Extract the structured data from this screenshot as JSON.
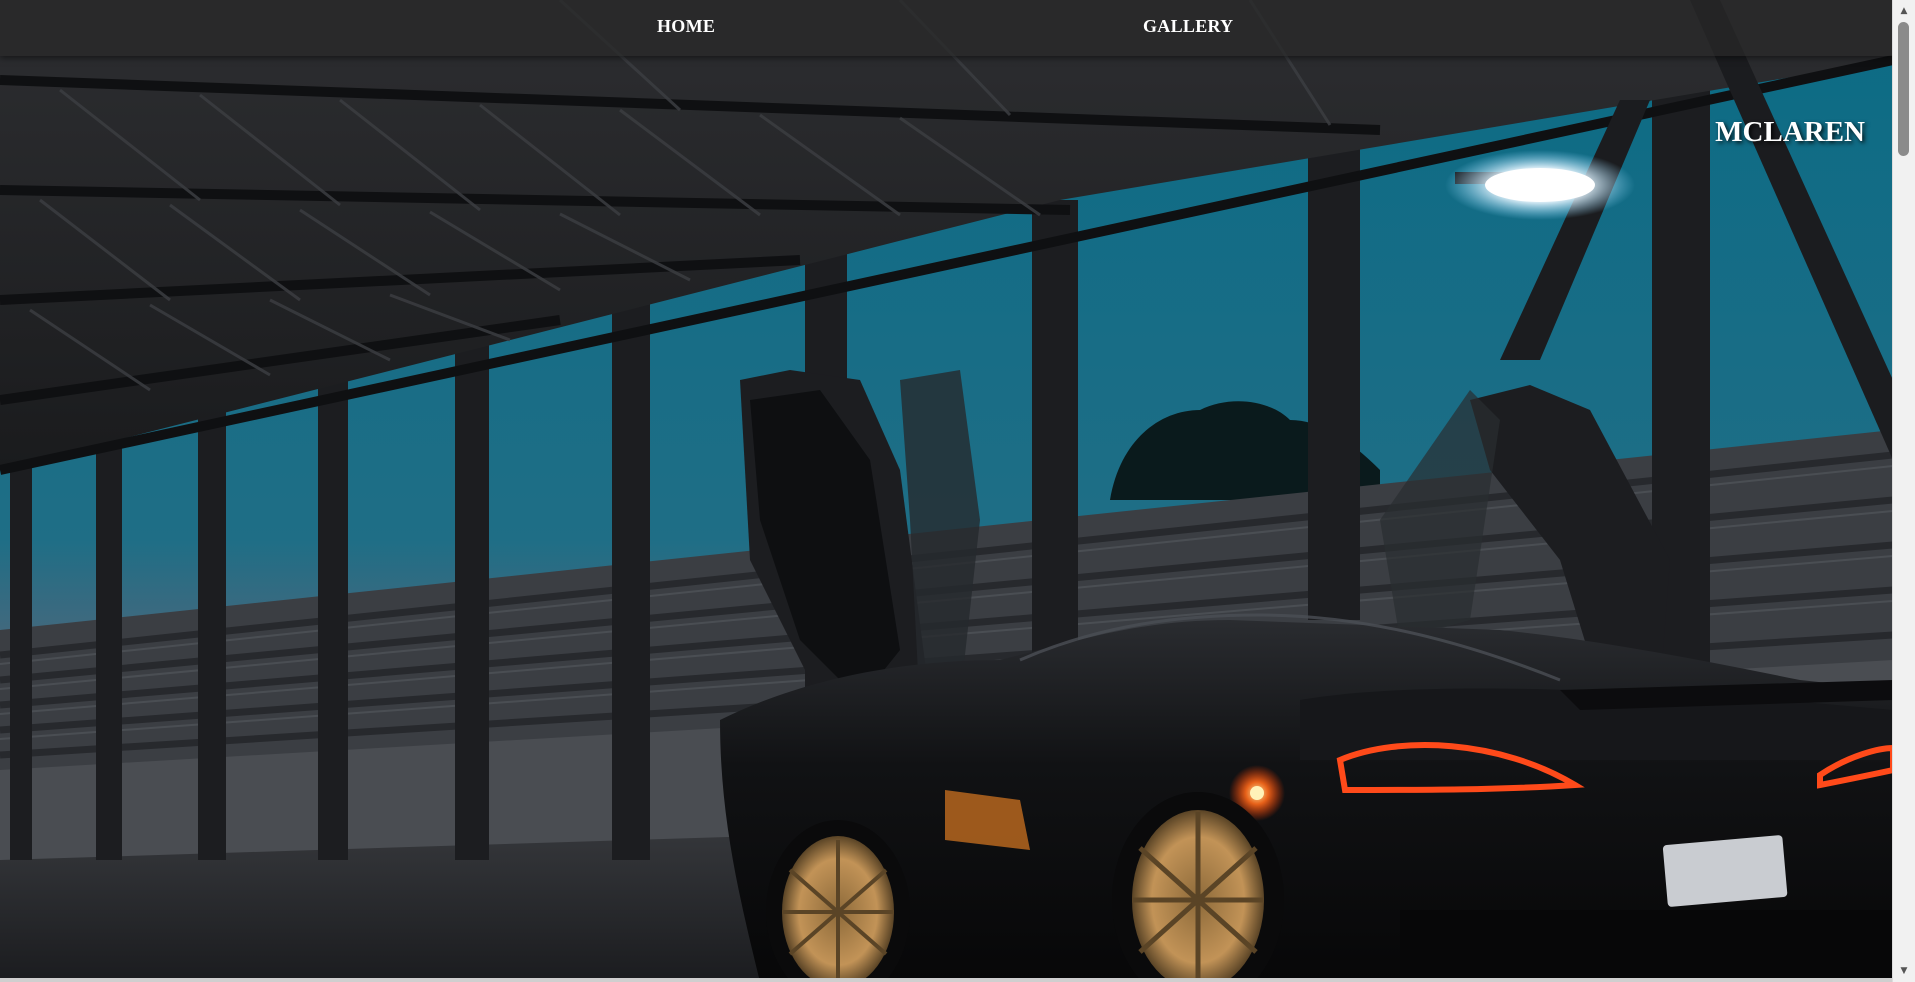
{
  "nav": {
    "home_label": "HOME",
    "gallery_label": "GALLERY"
  },
  "brand": {
    "title": "MCLAREN"
  },
  "hero": {
    "image": "mclaren-sports-car-in-parking-garage-at-dusk",
    "sky_top_color": "#0f6f86",
    "sky_horizon_color": "#c0705e",
    "car_color": "#141517",
    "wheel_color": "#b8894e",
    "taillight_color": "#ff4a1a"
  },
  "scrollbar": {
    "up_arrow_icon": "triangle-up-icon",
    "down_arrow_icon": "triangle-down-icon"
  }
}
